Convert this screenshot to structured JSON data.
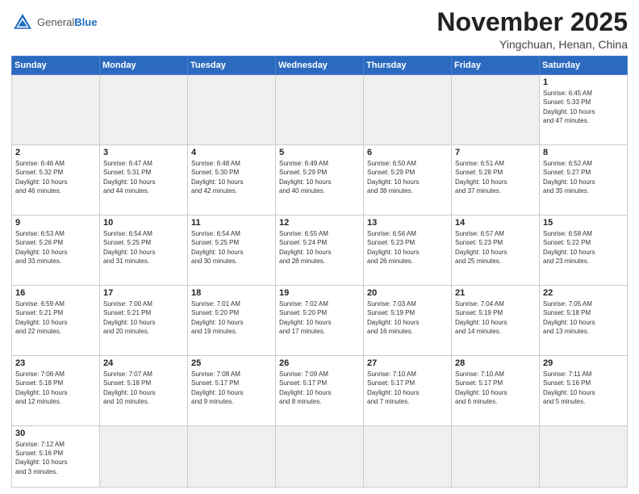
{
  "header": {
    "logo_general": "General",
    "logo_blue": "Blue",
    "month_title": "November 2025",
    "location": "Yingchuan, Henan, China"
  },
  "weekdays": [
    "Sunday",
    "Monday",
    "Tuesday",
    "Wednesday",
    "Thursday",
    "Friday",
    "Saturday"
  ],
  "weeks": [
    [
      {
        "day": "",
        "info": ""
      },
      {
        "day": "",
        "info": ""
      },
      {
        "day": "",
        "info": ""
      },
      {
        "day": "",
        "info": ""
      },
      {
        "day": "",
        "info": ""
      },
      {
        "day": "",
        "info": ""
      },
      {
        "day": "1",
        "info": "Sunrise: 6:45 AM\nSunset: 5:33 PM\nDaylight: 10 hours\nand 47 minutes."
      }
    ],
    [
      {
        "day": "2",
        "info": "Sunrise: 6:46 AM\nSunset: 5:32 PM\nDaylight: 10 hours\nand 46 minutes."
      },
      {
        "day": "3",
        "info": "Sunrise: 6:47 AM\nSunset: 5:31 PM\nDaylight: 10 hours\nand 44 minutes."
      },
      {
        "day": "4",
        "info": "Sunrise: 6:48 AM\nSunset: 5:30 PM\nDaylight: 10 hours\nand 42 minutes."
      },
      {
        "day": "5",
        "info": "Sunrise: 6:49 AM\nSunset: 5:29 PM\nDaylight: 10 hours\nand 40 minutes."
      },
      {
        "day": "6",
        "info": "Sunrise: 6:50 AM\nSunset: 5:29 PM\nDaylight: 10 hours\nand 38 minutes."
      },
      {
        "day": "7",
        "info": "Sunrise: 6:51 AM\nSunset: 5:28 PM\nDaylight: 10 hours\nand 37 minutes."
      },
      {
        "day": "8",
        "info": "Sunrise: 6:52 AM\nSunset: 5:27 PM\nDaylight: 10 hours\nand 35 minutes."
      }
    ],
    [
      {
        "day": "9",
        "info": "Sunrise: 6:53 AM\nSunset: 5:26 PM\nDaylight: 10 hours\nand 33 minutes."
      },
      {
        "day": "10",
        "info": "Sunrise: 6:54 AM\nSunset: 5:25 PM\nDaylight: 10 hours\nand 31 minutes."
      },
      {
        "day": "11",
        "info": "Sunrise: 6:54 AM\nSunset: 5:25 PM\nDaylight: 10 hours\nand 30 minutes."
      },
      {
        "day": "12",
        "info": "Sunrise: 6:55 AM\nSunset: 5:24 PM\nDaylight: 10 hours\nand 28 minutes."
      },
      {
        "day": "13",
        "info": "Sunrise: 6:56 AM\nSunset: 5:23 PM\nDaylight: 10 hours\nand 26 minutes."
      },
      {
        "day": "14",
        "info": "Sunrise: 6:57 AM\nSunset: 5:23 PM\nDaylight: 10 hours\nand 25 minutes."
      },
      {
        "day": "15",
        "info": "Sunrise: 6:58 AM\nSunset: 5:22 PM\nDaylight: 10 hours\nand 23 minutes."
      }
    ],
    [
      {
        "day": "16",
        "info": "Sunrise: 6:59 AM\nSunset: 5:21 PM\nDaylight: 10 hours\nand 22 minutes."
      },
      {
        "day": "17",
        "info": "Sunrise: 7:00 AM\nSunset: 5:21 PM\nDaylight: 10 hours\nand 20 minutes."
      },
      {
        "day": "18",
        "info": "Sunrise: 7:01 AM\nSunset: 5:20 PM\nDaylight: 10 hours\nand 19 minutes."
      },
      {
        "day": "19",
        "info": "Sunrise: 7:02 AM\nSunset: 5:20 PM\nDaylight: 10 hours\nand 17 minutes."
      },
      {
        "day": "20",
        "info": "Sunrise: 7:03 AM\nSunset: 5:19 PM\nDaylight: 10 hours\nand 16 minutes."
      },
      {
        "day": "21",
        "info": "Sunrise: 7:04 AM\nSunset: 5:19 PM\nDaylight: 10 hours\nand 14 minutes."
      },
      {
        "day": "22",
        "info": "Sunrise: 7:05 AM\nSunset: 5:18 PM\nDaylight: 10 hours\nand 13 minutes."
      }
    ],
    [
      {
        "day": "23",
        "info": "Sunrise: 7:06 AM\nSunset: 5:18 PM\nDaylight: 10 hours\nand 12 minutes."
      },
      {
        "day": "24",
        "info": "Sunrise: 7:07 AM\nSunset: 5:18 PM\nDaylight: 10 hours\nand 10 minutes."
      },
      {
        "day": "25",
        "info": "Sunrise: 7:08 AM\nSunset: 5:17 PM\nDaylight: 10 hours\nand 9 minutes."
      },
      {
        "day": "26",
        "info": "Sunrise: 7:09 AM\nSunset: 5:17 PM\nDaylight: 10 hours\nand 8 minutes."
      },
      {
        "day": "27",
        "info": "Sunrise: 7:10 AM\nSunset: 5:17 PM\nDaylight: 10 hours\nand 7 minutes."
      },
      {
        "day": "28",
        "info": "Sunrise: 7:10 AM\nSunset: 5:17 PM\nDaylight: 10 hours\nand 6 minutes."
      },
      {
        "day": "29",
        "info": "Sunrise: 7:11 AM\nSunset: 5:16 PM\nDaylight: 10 hours\nand 5 minutes."
      }
    ],
    [
      {
        "day": "30",
        "info": "Sunrise: 7:12 AM\nSunset: 5:16 PM\nDaylight: 10 hours\nand 3 minutes."
      },
      {
        "day": "",
        "info": ""
      },
      {
        "day": "",
        "info": ""
      },
      {
        "day": "",
        "info": ""
      },
      {
        "day": "",
        "info": ""
      },
      {
        "day": "",
        "info": ""
      },
      {
        "day": "",
        "info": ""
      }
    ]
  ]
}
